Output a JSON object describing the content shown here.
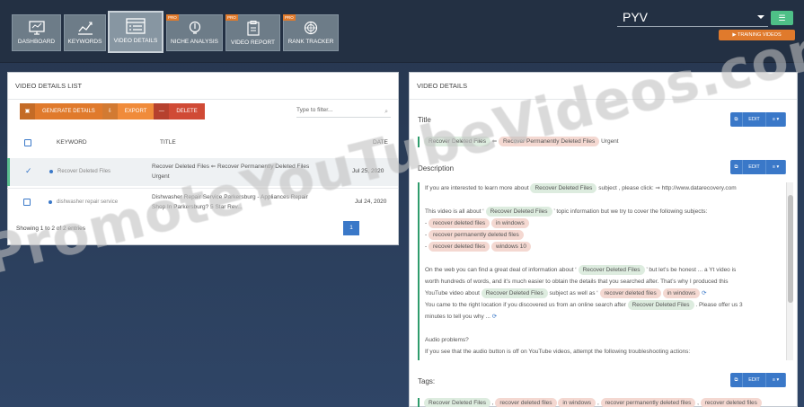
{
  "nav": [
    {
      "label": "DASHBOARD",
      "icon": "monitor-icon",
      "pro": ""
    },
    {
      "label": "KEYWORDS",
      "icon": "chart-icon",
      "pro": ""
    },
    {
      "label": "VIDEO DETAILS",
      "icon": "list-icon",
      "pro": ""
    },
    {
      "label": "NICHE ANALYSIS",
      "icon": "bulb-icon",
      "pro": "PRO"
    },
    {
      "label": "VIDEO REPORT",
      "icon": "clipboard-icon",
      "pro": "PRO"
    },
    {
      "label": "RANK TRACKER",
      "icon": "target-icon",
      "pro": "PRO"
    }
  ],
  "project_select": {
    "value": "PYV"
  },
  "training_label": "TRAINING VIDEOS",
  "left_panel": {
    "title": "VIDEO DETAILS LIST",
    "generate_label": "GENERATE DETAILS",
    "export_label": "EXPORT",
    "delete_label": "DELETE",
    "filter_placeholder": "Type to filter...",
    "columns": {
      "keyword": "KEYWORD",
      "title": "TITLE",
      "date": "DATE"
    },
    "rows": [
      {
        "keyword": "Recover Deleted Files",
        "title_line1": "Recover Deleted Files ⇐ Recover Permanently Deleted Files",
        "title_line2": "Urgent",
        "date": "Jul 25, 2020"
      },
      {
        "keyword": "dishwasher repair service",
        "title_line1": "Dishwasher Repair Service Parkersburg - Appliances Repair",
        "title_line2": "Shop In Parkersburg? 5 Star Rev...",
        "date": "Jul 24, 2020"
      }
    ],
    "showing": "Showing 1 to 2 of 2 entries",
    "page": "1"
  },
  "right_panel": {
    "title": "VIDEO DETAILS",
    "title_label": "Title",
    "description_label": "Description",
    "tags_label": "Tags:",
    "edit_label": "EDIT",
    "title_tag1": "Recover Deleted Files",
    "title_arrow": "⇐",
    "title_tag2": "Recover Permanently Deleted Files",
    "title_suffix": "Urgent",
    "desc": {
      "l1a": "If you are interested to learn more about",
      "l1tag": "Recover Deleted Files",
      "l1b": "subject , please click: ⇒ http://www.datarecovery.com",
      "l2a": "This video is all about ‘",
      "l2tag": "Recover Deleted Files",
      "l2b": "’ topic information but we try to cover the following subjects:",
      "b1a": "recover deleted files",
      "b1b": "in windows",
      "b2": "recover permanently deleted files",
      "b3a": "recover deleted files",
      "b3b": "windows 10",
      "p1a": "On the web you can find a great deal of information about ‘",
      "p1tag": "Recover Deleted Files",
      "p1b": "’ but let’s be honest ... a Yt video is",
      "p2": "worth hundreds of words, and it’s much easier to obtain the details that you searched after. That’s why I produced this",
      "p3a": "YouTube video about",
      "p3tag": "Recover Deleted Files",
      "p3b": "subject as well as ‘",
      "p3tag2a": "recover deleted files",
      "p3tag2b": "in windows",
      "p4a": "You came to the right location if you discovered us from an online search after",
      "p4tag": "Recover Deleted Files",
      "p4b": ". Please offer us 3",
      "p5": "minutes to tell you why ...",
      "p6": "Audio problems?",
      "p7": "If you see that the audio button is off on YouTube videos, attempt the following troubleshooting actions:"
    },
    "tags": [
      "Recover Deleted Files",
      "recover deleted files",
      "in windows",
      "recover permanently deleted files",
      "recover deleted files"
    ]
  },
  "watermark": "PromoteYouTubeVideos.com"
}
